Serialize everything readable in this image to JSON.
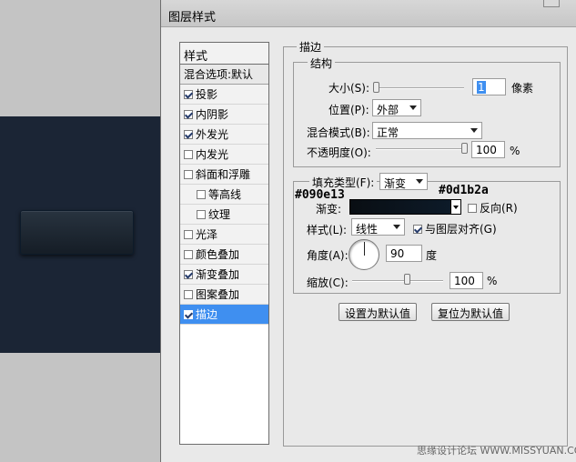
{
  "dialog": {
    "title": "图层样式"
  },
  "left_panel": {
    "header": "样式",
    "blend_options": "混合选项:默认",
    "items": [
      {
        "label": "投影",
        "checked": true
      },
      {
        "label": "内阴影",
        "checked": true
      },
      {
        "label": "外发光",
        "checked": true
      },
      {
        "label": "内发光",
        "checked": false
      },
      {
        "label": "斜面和浮雕",
        "checked": false
      },
      {
        "label": "等高线",
        "checked": false,
        "sub": true
      },
      {
        "label": "纹理",
        "checked": false,
        "sub": true
      },
      {
        "label": "光泽",
        "checked": false
      },
      {
        "label": "颜色叠加",
        "checked": false
      },
      {
        "label": "渐变叠加",
        "checked": true
      },
      {
        "label": "图案叠加",
        "checked": false
      },
      {
        "label": "描边",
        "checked": true,
        "active": true
      }
    ]
  },
  "stroke": {
    "section_title": "描边",
    "structure_title": "结构",
    "size_label": "大小(S):",
    "size_value": "1",
    "size_unit": "像素",
    "position_label": "位置(P):",
    "position_value": "外部",
    "blend_label": "混合模式(B):",
    "blend_value": "正常",
    "opacity_label": "不透明度(O):",
    "opacity_value": "100",
    "opacity_unit": "%"
  },
  "fill": {
    "type_label": "填充类型(F):",
    "type_value": "渐变",
    "gradient_label": "渐变:",
    "color_start": "#090e13",
    "color_end": "#0d1b2a",
    "reverse_label": "反向(R)",
    "reverse_checked": false,
    "style_label": "样式(L):",
    "style_value": "线性",
    "align_label": "与图层对齐(G)",
    "align_checked": true,
    "angle_label": "角度(A):",
    "angle_value": "90",
    "angle_unit": "度",
    "scale_label": "缩放(C):",
    "scale_value": "100",
    "scale_unit": "%"
  },
  "buttons": {
    "set_default": "设置为默认值",
    "reset_default": "复位为默认值"
  },
  "watermark": "思缘设计论坛 WWW.MISSYUAN.COM"
}
